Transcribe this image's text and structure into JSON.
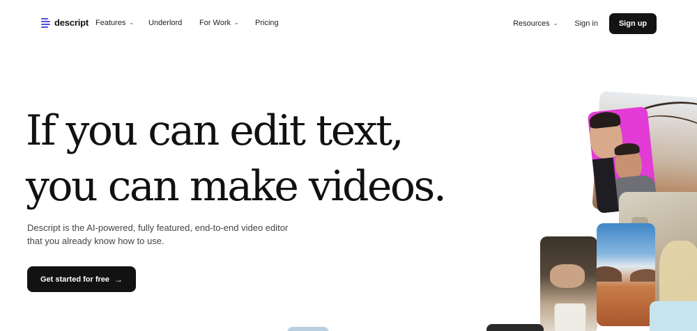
{
  "header": {
    "logo_text": "descript",
    "nav_left": [
      {
        "label": "Features",
        "has_dropdown": true
      },
      {
        "label": "Underlord",
        "has_dropdown": false
      },
      {
        "label": "For Work",
        "has_dropdown": true
      },
      {
        "label": "Pricing",
        "has_dropdown": false
      }
    ],
    "nav_right": [
      {
        "label": "Resources",
        "has_dropdown": true
      },
      {
        "label": "Sign in",
        "has_dropdown": false
      }
    ],
    "signup_label": "Sign up",
    "chevron_glyph": "⌄"
  },
  "hero": {
    "title_line1": "If you can edit text,",
    "title_line2": "you can make videos.",
    "subtitle_line1": "Descript is the AI-powered, fully featured, end-to-end video editor",
    "subtitle_line2": "that you already know how to use.",
    "cta_label": "Get started for free",
    "cta_arrow": "→"
  },
  "colors": {
    "brand_logo": "#4a4ae0",
    "button_dark": "#131313",
    "text_primary": "#111111",
    "text_secondary": "#444444"
  }
}
